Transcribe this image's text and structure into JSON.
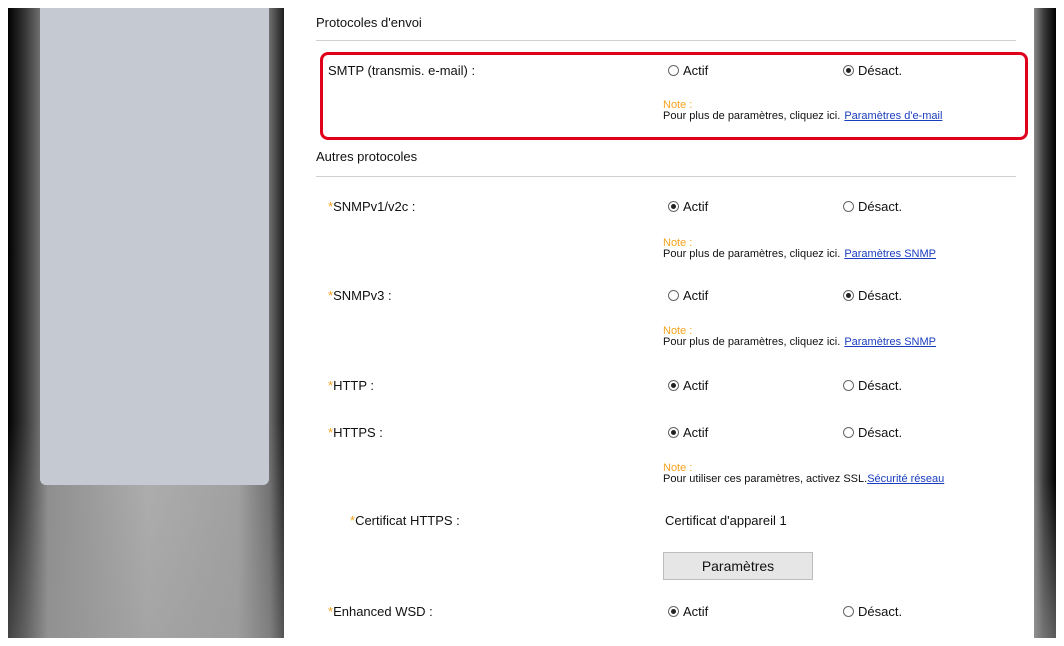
{
  "sections": {
    "sending": "Protocoles d'envoi",
    "other": "Autres protocoles"
  },
  "common": {
    "on_label": "Actif",
    "off_label": "Désact.",
    "required_mark": "*",
    "note_title": "Note :",
    "note_more": "Pour plus de paramètres, cliquez ici."
  },
  "smtp": {
    "label": "SMTP (transmis. e-mail) :",
    "value": "off",
    "link": "Paramètres d'e-mail"
  },
  "snmpv1": {
    "label": "SNMPv1/v2c :",
    "value": "on",
    "link": "Paramètres SNMP"
  },
  "snmpv3": {
    "label": "SNMPv3 :",
    "value": "off",
    "link": "Paramètres SNMP"
  },
  "http": {
    "label": "HTTP :",
    "value": "on"
  },
  "https": {
    "label": "HTTPS :",
    "value": "on",
    "note_text": "Pour utiliser ces paramètres, activez SSL.",
    "link": "Sécurité réseau"
  },
  "cert": {
    "label": "Certificat HTTPS :",
    "value": "Certificat d'appareil 1",
    "button": "Paramètres"
  },
  "wsd": {
    "label": "Enhanced WSD :",
    "value": "on"
  },
  "colors": {
    "highlight": "#e0001b",
    "required": "#f7a31e",
    "link": "#1a3dbf"
  }
}
